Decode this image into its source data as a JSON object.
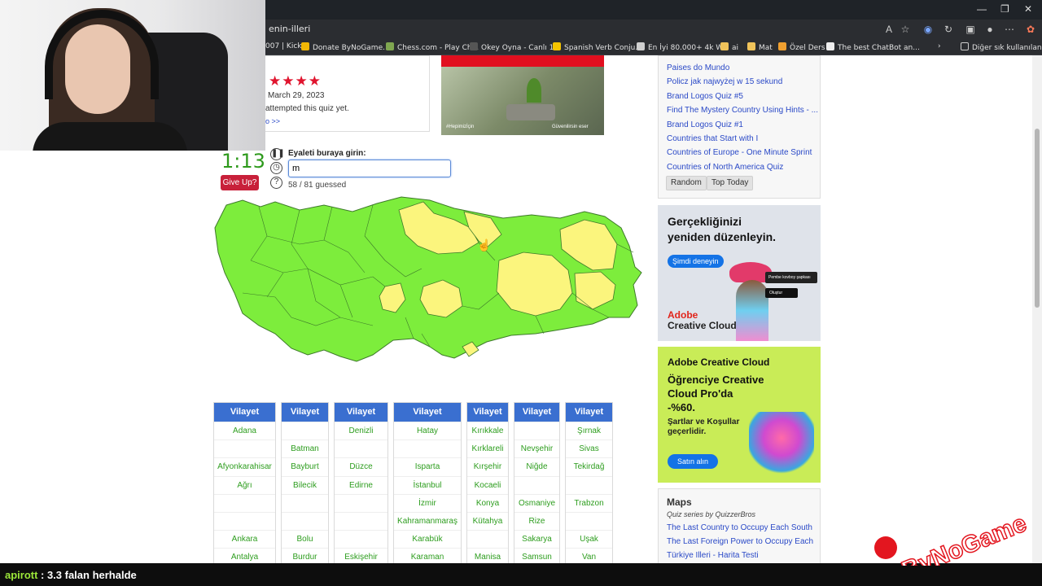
{
  "browser": {
    "url_text": "enin-illeri",
    "bookmarks": [
      {
        "label": "007 | Kick",
        "color": "#53fc18"
      },
      {
        "label": "Donate ByNoGame...",
        "color": "#f2b705"
      },
      {
        "label": "Chess.com - Play Ch...",
        "color": "#7fa650"
      },
      {
        "label": "Okey Oyna - Canlı 1...",
        "color": "#4b4b4b"
      },
      {
        "label": "Spanish Verb Conju...",
        "color": "#f5c400"
      },
      {
        "label": "En İyi 80.000+ 4k W...",
        "color": "#cfcfcf"
      },
      {
        "label": "ai",
        "color": "#f0c35a"
      },
      {
        "label": "Mat",
        "color": "#f0c35a"
      },
      {
        "label": "Özel Ders",
        "color": "#f0a030"
      },
      {
        "label": "The best ChatBot an...",
        "color": "#eeeeee"
      }
    ],
    "other_bookmarks": "Diğer sık kullanılanlar"
  },
  "quiz": {
    "date": "March 29, 2023",
    "attempted": "attempted this quiz yet.",
    "more_link": "o >>",
    "timer": "1:13",
    "give_up": "Give Up?",
    "prompt_label": "Eyaleti buraya girin:",
    "input_value": "m",
    "guessed": "58 / 81 guessed"
  },
  "sidebar": {
    "links_top": [
      "Paises do Mundo",
      "Policz jak najwyżej w 15 sekund",
      "Brand Logos Quiz #5",
      "Find The Mystery Country Using Hints - ...",
      "Brand Logos Quiz #1",
      "Countries that Start with I",
      "Countries of Europe - One Minute Sprint",
      "Countries of North America Quiz"
    ],
    "random": "Random",
    "top_today": "Top Today",
    "maps_title": "Maps",
    "maps_sub": "Quiz series by QuizzerBros",
    "maps_links": [
      "The Last Country to Occupy Each South ...",
      "The Last Foreign Power to Occupy Each...",
      "Türkiye İlleri - Harita Testi"
    ]
  },
  "ads": {
    "ad1_line1": "Gerçekliğinizi",
    "ad1_line2": "yeniden düzenleyin.",
    "ad1_button": "Şimdi deneyin",
    "ad1_brand1": "Adobe",
    "ad1_brand2": "Creative Cloud",
    "ad1_popup1": "Pembe kovboy şapkası",
    "ad1_popup2": "Oluştur",
    "ad2_brand": "Adobe Creative Cloud",
    "ad2_line1": "Öğrenciye Creative",
    "ad2_line2": "Cloud Pro'da",
    "ad2_line3": "-%60.",
    "ad2_line4": "Şartlar ve Koşullar",
    "ad2_line5": "geçerlidir.",
    "ad2_button": "Satın alın",
    "banner_caption_left": "#Hepimizİçin",
    "banner_caption_right": "Güvenilirsin eser"
  },
  "table": {
    "header": "Vilayet",
    "columns": [
      [
        "Adana",
        "",
        "Afyonkarahisar",
        "Ağrı",
        "",
        "",
        "Ankara",
        "Antalya"
      ],
      [
        "",
        "Batman",
        "Bayburt",
        "Bilecik",
        "",
        "",
        "Bolu",
        "Burdur"
      ],
      [
        "Denizli",
        "",
        "Düzce",
        "Edirne",
        "",
        "",
        "",
        "Eskişehir"
      ],
      [
        "Hatay",
        "",
        "Isparta",
        "İstanbul",
        "İzmir",
        "Kahramanmaraş",
        "Karabük",
        "Karaman"
      ],
      [
        "Kırıkkale",
        "Kırklareli",
        "Kırşehir",
        "Kocaeli",
        "Konya",
        "Kütahya",
        "",
        "Manisa"
      ],
      [
        "",
        "Nevşehir",
        "Niğde",
        "",
        "Osmaniye",
        "Rize",
        "Sakarya",
        "Samsun"
      ],
      [
        "Şırnak",
        "Sivas",
        "Tekirdağ",
        "",
        "Trabzon",
        "",
        "Uşak",
        "Van"
      ]
    ]
  },
  "map": {
    "guessed_color": "#7ded3c",
    "remaining_color": "#fbf57d",
    "border_color": "#3d7a2a"
  },
  "chat": {
    "user": "apirott",
    "message": ": 3.3 falan herhalde"
  },
  "logo_text": "ByNoGame"
}
